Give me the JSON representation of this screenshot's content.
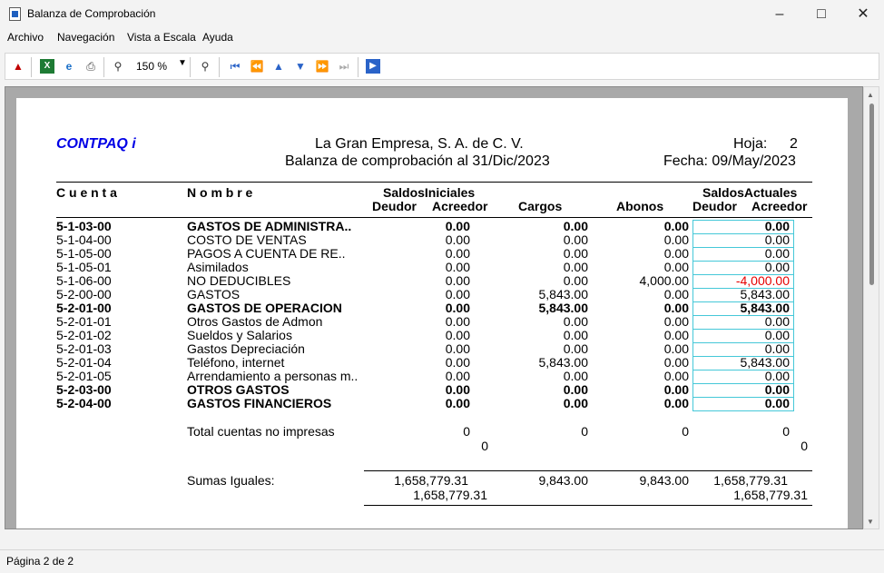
{
  "window": {
    "title": "Balanza de Comprobación"
  },
  "menu": [
    "Archivo",
    "Navegación",
    "Vista a Escala",
    "Ayuda"
  ],
  "toolbar": {
    "zoom": "150 %"
  },
  "report": {
    "brand": "CONTPAQ i",
    "company": "La Gran Empresa, S. A. de C. V.",
    "subtitle": "Balanza de comprobación al 31/Dic/2023",
    "sheet_label": "Hoja:",
    "sheet_num": "2",
    "date": "Fecha: 09/May/2023",
    "columns": {
      "cuenta": "C u e n t a",
      "nombre": "N o m b r e",
      "saldos_iniciales": "SaldosIniciales",
      "deudor": "Deudor",
      "acreedor": "Acreedor",
      "cargos": "Cargos",
      "abonos": "Abonos",
      "saldos_actuales": "SaldosActuales",
      "deudor2": "Deudor",
      "acreedor2": "Acreedor"
    },
    "rows": [
      {
        "cuenta": "5-1-03-00",
        "nombre": "GASTOS DE ADMINISTRA..",
        "inicial": "0.00",
        "cargos": "0.00",
        "abonos": "0.00",
        "actual": "0.00",
        "bold": true
      },
      {
        "cuenta": "5-1-04-00",
        "nombre": "COSTO DE VENTAS",
        "inicial": "0.00",
        "cargos": "0.00",
        "abonos": "0.00",
        "actual": "0.00",
        "bold": false
      },
      {
        "cuenta": "5-1-05-00",
        "nombre": "PAGOS A CUENTA DE RE..",
        "inicial": "0.00",
        "cargos": "0.00",
        "abonos": "0.00",
        "actual": "0.00",
        "bold": false
      },
      {
        "cuenta": "5-1-05-01",
        "nombre": "Asimilados",
        "inicial": "0.00",
        "cargos": "0.00",
        "abonos": "0.00",
        "actual": "0.00",
        "bold": false
      },
      {
        "cuenta": "5-1-06-00",
        "nombre": "NO DEDUCIBLES",
        "inicial": "0.00",
        "cargos": "0.00",
        "abonos": "4,000.00",
        "actual": "-4,000.00",
        "bold": false,
        "negative": true
      },
      {
        "cuenta": "5-2-00-00",
        "nombre": "GASTOS",
        "inicial": "0.00",
        "cargos": "5,843.00",
        "abonos": "0.00",
        "actual": "5,843.00",
        "bold": false
      },
      {
        "cuenta": "5-2-01-00",
        "nombre": "GASTOS DE OPERACION",
        "inicial": "0.00",
        "cargos": "5,843.00",
        "abonos": "0.00",
        "actual": "5,843.00",
        "bold": true
      },
      {
        "cuenta": "5-2-01-01",
        "nombre": "Otros Gastos de Admon",
        "inicial": "0.00",
        "cargos": "0.00",
        "abonos": "0.00",
        "actual": "0.00",
        "bold": false
      },
      {
        "cuenta": "5-2-01-02",
        "nombre": "Sueldos y Salarios",
        "inicial": "0.00",
        "cargos": "0.00",
        "abonos": "0.00",
        "actual": "0.00",
        "bold": false
      },
      {
        "cuenta": "5-2-01-03",
        "nombre": "Gastos Depreciación",
        "inicial": "0.00",
        "cargos": "0.00",
        "abonos": "0.00",
        "actual": "0.00",
        "bold": false
      },
      {
        "cuenta": "5-2-01-04",
        "nombre": "Teléfono, internet",
        "inicial": "0.00",
        "cargos": "5,843.00",
        "abonos": "0.00",
        "actual": "5,843.00",
        "bold": false
      },
      {
        "cuenta": "5-2-01-05",
        "nombre": "Arrendamiento a personas m..",
        "inicial": "0.00",
        "cargos": "0.00",
        "abonos": "0.00",
        "actual": "0.00",
        "bold": false
      },
      {
        "cuenta": "5-2-03-00",
        "nombre": "OTROS GASTOS",
        "inicial": "0.00",
        "cargos": "0.00",
        "abonos": "0.00",
        "actual": "0.00",
        "bold": true
      },
      {
        "cuenta": "5-2-04-00",
        "nombre": "GASTOS FINANCIEROS",
        "inicial": "0.00",
        "cargos": "0.00",
        "abonos": "0.00",
        "actual": "0.00",
        "bold": true
      }
    ],
    "total": {
      "label": "Total cuentas no impresas",
      "inicial_d": "0",
      "inicial_a": "0",
      "cargos": "0",
      "abonos": "0",
      "actual_d": "0",
      "actual_a": "0"
    },
    "sumas": {
      "label": "Sumas Iguales:",
      "inicial_d": "1,658,779.31",
      "inicial_a": "1,658,779.31",
      "cargos": "9,843.00",
      "abonos": "9,843.00",
      "actual_d": "1,658,779.31",
      "actual_a": "1,658,779.31"
    }
  },
  "status": {
    "page": "Página 2 de 2"
  }
}
